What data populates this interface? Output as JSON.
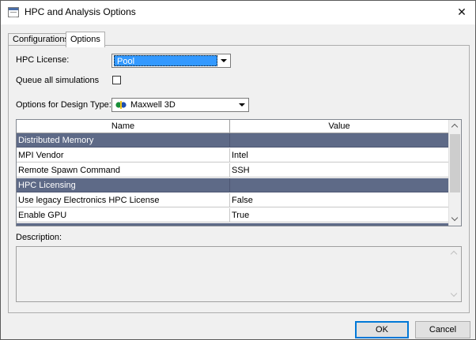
{
  "window": {
    "title": "HPC and Analysis Options",
    "close_glyph": "✕"
  },
  "tabs": [
    {
      "label": "Configurations",
      "active": false
    },
    {
      "label": "Options",
      "active": true
    }
  ],
  "options": {
    "hpc_license_label": "HPC License:",
    "hpc_license_value": "Pool",
    "queue_label": "Queue all simulations",
    "queue_checked": false,
    "design_type_label": "Options for Design Type:",
    "design_type_value": "Maxwell 3D"
  },
  "grid": {
    "columns": {
      "name": "Name",
      "value": "Value"
    },
    "rows": [
      {
        "name": "Distributed Memory",
        "value": "",
        "category": true
      },
      {
        "name": "MPI Vendor",
        "value": "Intel",
        "category": false
      },
      {
        "name": "Remote Spawn Command",
        "value": "SSH",
        "category": false
      },
      {
        "name": "HPC Licensing",
        "value": "",
        "category": true
      },
      {
        "name": "Use legacy Electronics HPC License",
        "value": "False",
        "category": false
      },
      {
        "name": "Enable GPU",
        "value": "True",
        "category": false
      }
    ]
  },
  "description": {
    "label": "Description:",
    "text": ""
  },
  "buttons": {
    "ok": "OK",
    "cancel": "Cancel"
  },
  "colors": {
    "category_row": "#5e6a87",
    "selection": "#3399ff",
    "default_button_border": "#0078d7"
  },
  "icons": {
    "app": "dialog-window-icon",
    "design_type": "maxwell-3d-icon"
  }
}
